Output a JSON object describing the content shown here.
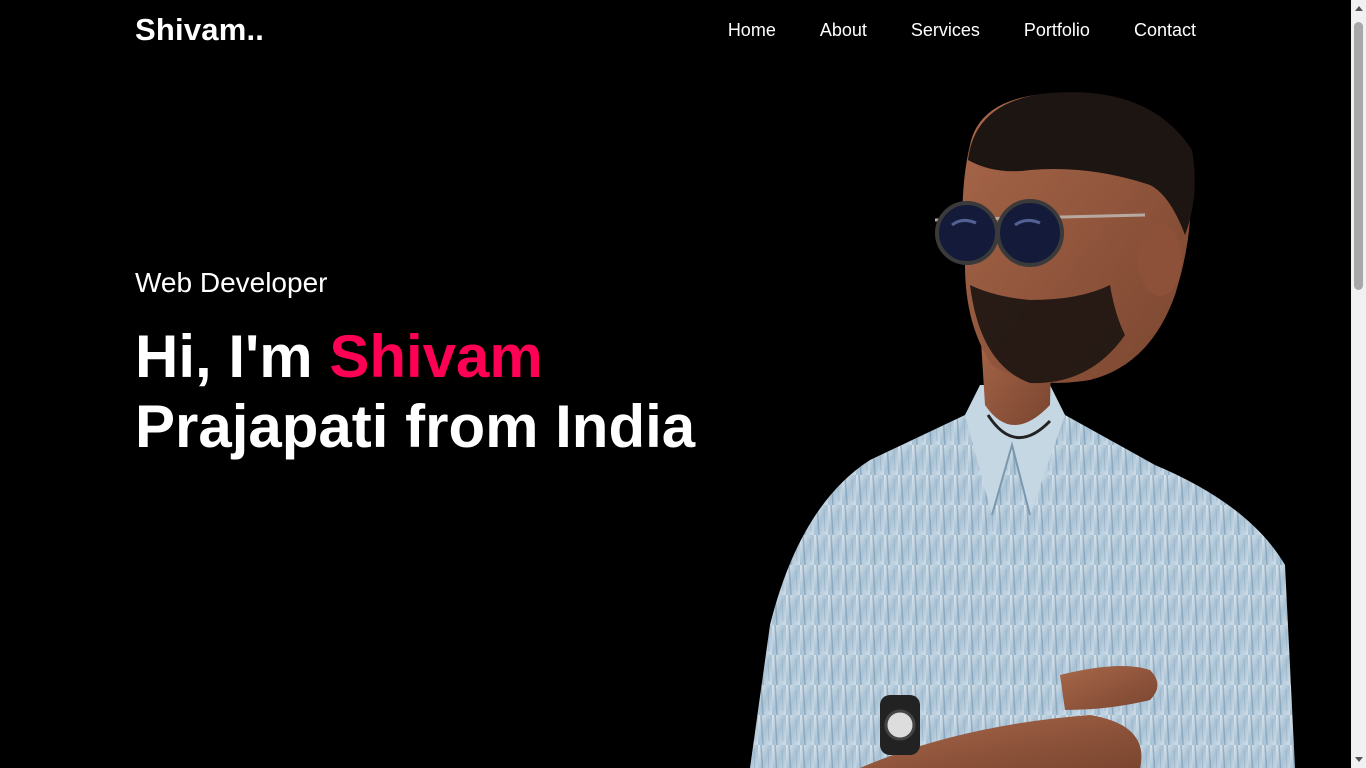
{
  "header": {
    "logo": "Shivam..",
    "nav": [
      {
        "label": "Home"
      },
      {
        "label": "About"
      },
      {
        "label": "Services"
      },
      {
        "label": "Portfolio"
      },
      {
        "label": "Contact"
      }
    ]
  },
  "hero": {
    "subtitle": "Web Developer",
    "greeting": "Hi, I'm",
    "name": "Shivam",
    "rest": "Prajapati from India",
    "portrait_icon": "person-photo"
  },
  "colors": {
    "background": "#000000",
    "text": "#ffffff",
    "accent": "#ff0055"
  }
}
